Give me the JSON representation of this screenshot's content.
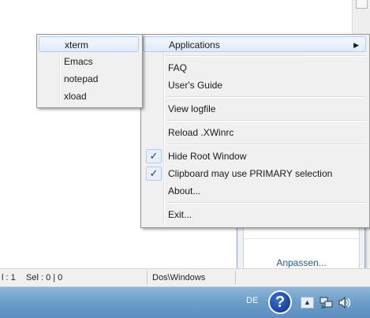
{
  "submenu": {
    "items": [
      {
        "label": "xterm"
      },
      {
        "label": "Emacs"
      },
      {
        "label": "notepad"
      },
      {
        "label": "xload"
      }
    ]
  },
  "main_menu": {
    "applications_label": "Applications",
    "faq_label": "FAQ",
    "users_guide_label": "User's Guide",
    "view_logfile_label": "View logfile",
    "reload_label": "Reload .XWinrc",
    "hide_root_label": "Hide Root Window",
    "hide_root_checked": true,
    "clipboard_label": "Clipboard may use PRIMARY selection",
    "clipboard_checked": true,
    "about_label": "About...",
    "exit_label": "Exit...",
    "check_glyph": "✓",
    "arrow_glyph": "▶"
  },
  "tray_popup": {
    "customize_label": "Anpassen..."
  },
  "statusbar": {
    "position": "l : 1",
    "selection": "Sel : 0 | 0",
    "line_endings": "Dos\\Windows"
  },
  "taskbar": {
    "language": "DE",
    "help_glyph": "?",
    "show_hidden_glyph": "▲"
  },
  "colors": {
    "menu_bg": "#f0f0f0",
    "highlight_border": "#aecff7",
    "taskbar": "#6e9fca",
    "link": "#1e5aa8"
  }
}
